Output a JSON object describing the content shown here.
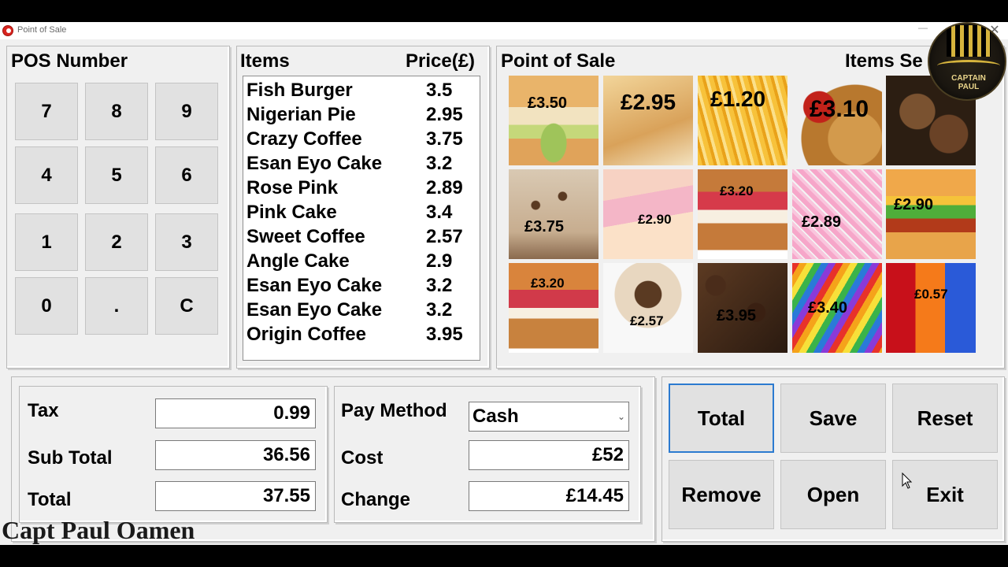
{
  "window": {
    "title": "Point of Sale",
    "min_glyph": "—",
    "close_glyph": "✕"
  },
  "pos_panel": {
    "title": "POS Number",
    "keys": [
      "7",
      "8",
      "9",
      "4",
      "5",
      "6",
      "1",
      "2",
      "3",
      "0",
      ".",
      "C"
    ]
  },
  "items_panel": {
    "title_items": "Items",
    "title_price": "Price(£)",
    "rows": [
      {
        "name": "Fish Burger",
        "price": "3.5"
      },
      {
        "name": "Nigerian Pie",
        "price": "2.95"
      },
      {
        "name": "Crazy Coffee",
        "price": "3.75"
      },
      {
        "name": "Esan Eyo Cake",
        "price": "3.2"
      },
      {
        "name": "Rose Pink",
        "price": "2.89"
      },
      {
        "name": "Pink Cake",
        "price": "3.4"
      },
      {
        "name": "Sweet Coffee",
        "price": "2.57"
      },
      {
        "name": "Angle Cake",
        "price": "2.9"
      },
      {
        "name": "Esan Eyo Cake",
        "price": "3.2"
      },
      {
        "name": "Esan Eyo Cake",
        "price": "3.2"
      },
      {
        "name": "Origin Coffee",
        "price": "3.95"
      }
    ]
  },
  "sale_panel": {
    "title": "Point of Sale",
    "title_right": "Items Se",
    "tiles": [
      {
        "price": "£3.50",
        "icon": "burger-image"
      },
      {
        "price": "£2.95",
        "icon": "pie-image"
      },
      {
        "price": "£1.20",
        "icon": "fries-image"
      },
      {
        "price": "£3.10",
        "icon": "nuggets-image"
      },
      {
        "price": "",
        "icon": "meatballs-image"
      },
      {
        "price": "£3.75",
        "icon": "coffee-dessert-image"
      },
      {
        "price": "£2.90",
        "icon": "angel-cake-image"
      },
      {
        "price": "£3.20",
        "icon": "sponge-cake-image"
      },
      {
        "price": "£2.89",
        "icon": "pink-cake-image"
      },
      {
        "price": "£2.90",
        "icon": "cheeseburger-image"
      },
      {
        "price": "£3.20",
        "icon": "victoria-sponge-image"
      },
      {
        "price": "£2.57",
        "icon": "cappuccino-image"
      },
      {
        "price": "£3.95",
        "icon": "coffee-beans-image"
      },
      {
        "price": "£3.40",
        "icon": "rainbow-cake-image"
      },
      {
        "price": "£0.57",
        "icon": "soda-cans-image"
      }
    ]
  },
  "totals": {
    "tax_label": "Tax",
    "tax_value": "0.99",
    "subtotal_label": "Sub Total",
    "subtotal_value": "36.56",
    "total_label": "Total",
    "total_value": "37.55"
  },
  "payment": {
    "method_label": "Pay Method",
    "method_value": "Cash",
    "cost_label": "Cost",
    "cost_value": "£52",
    "change_label": "Change",
    "change_value": "£14.45"
  },
  "actions": {
    "total": "Total",
    "save": "Save",
    "reset": "Reset",
    "remove": "Remove",
    "open": "Open",
    "exit": "Exit"
  },
  "logo": {
    "line1": "CAPTAIN",
    "line2": "PAUL"
  },
  "signature": "Capt Paul Oamen"
}
